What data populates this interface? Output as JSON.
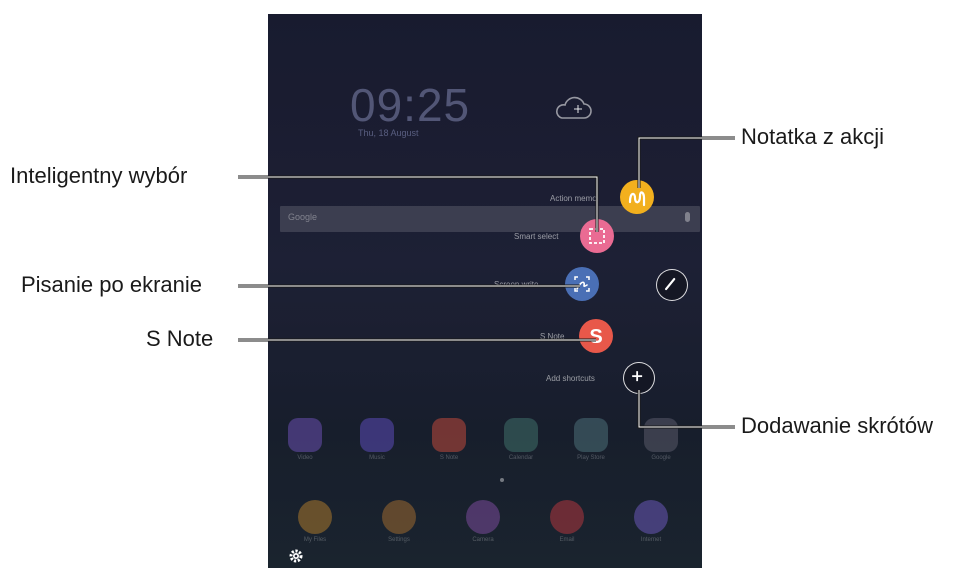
{
  "callouts": {
    "notatka": "Notatka z akcji",
    "inteligentny": "Inteligentny wybór",
    "pisanie": "Pisanie po ekranie",
    "snote": "S Note",
    "dodawanie": "Dodawanie skrótów"
  },
  "tablet": {
    "clock": "09:25",
    "date": "Thu, 18 August",
    "search_placeholder": "Google",
    "menu": {
      "action_memo": "Action memo",
      "smart_select": "Smart select",
      "screen_write": "Screen write",
      "s_note": "S Note",
      "add_shortcuts": "Add shortcuts"
    },
    "apps_row1": [
      "Video",
      "Music",
      "S Note",
      "Calendar",
      "Play Store",
      "Google"
    ],
    "apps_row2": [
      "My Files",
      "Settings",
      "Camera",
      "Email",
      "Internet"
    ]
  },
  "colors": {
    "action_memo": "#f2b01e",
    "smart_select": "#ea6b93",
    "screen_write": "#4a6fb5",
    "s_note": "#e8584a",
    "callout_line": "#1a1a1a"
  },
  "icons": {
    "cloud": "cloud-plus-icon",
    "pen": "pen-icon",
    "plus": "plus-icon",
    "settings": "gear-icon"
  }
}
